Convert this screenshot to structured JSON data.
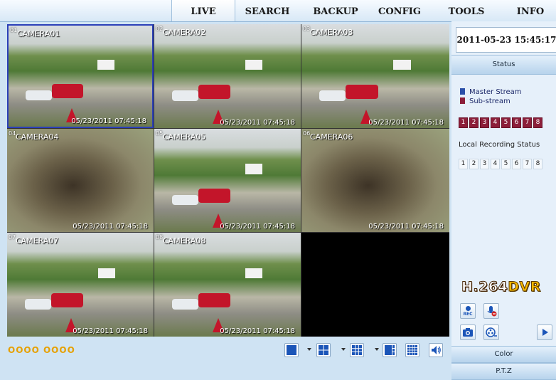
{
  "nav": {
    "tabs": [
      {
        "label": "LIVE",
        "active": true
      },
      {
        "label": "SEARCH",
        "active": false
      },
      {
        "label": "BACKUP",
        "active": false
      },
      {
        "label": "CONFIG",
        "active": false
      },
      {
        "label": "TOOLS",
        "active": false
      },
      {
        "label": "INFO",
        "active": false
      }
    ]
  },
  "grid": {
    "cells": [
      {
        "num": "01",
        "camera": "CAMERA01",
        "timestamp": "05/23/2011 07:45:18",
        "selected": true
      },
      {
        "num": "02",
        "camera": "CAMERA02",
        "timestamp": "05/23/2011 07:45:18",
        "selected": false
      },
      {
        "num": "03",
        "camera": "CAMERA03",
        "timestamp": "05/23/2011 07:45:18",
        "selected": false
      },
      {
        "num": "04",
        "camera": "CAMERA04",
        "timestamp": "05/23/2011 07:45:18",
        "selected": false
      },
      {
        "num": "05",
        "camera": "CAMERA05",
        "timestamp": "05/23/2011 07:45:18",
        "selected": false
      },
      {
        "num": "06",
        "camera": "CAMERA06",
        "timestamp": "05/23/2011 07:45:18",
        "selected": false
      },
      {
        "num": "07",
        "camera": "CAMERA07",
        "timestamp": "05/23/2011 07:45:18",
        "selected": false
      },
      {
        "num": "08",
        "camera": "CAMERA08",
        "timestamp": "05/23/2011 07:45:18",
        "selected": false
      },
      {
        "num": "",
        "camera": "",
        "timestamp": "",
        "selected": false
      }
    ]
  },
  "panel": {
    "datetime": "2011-05-23 15:45:17",
    "status_label": "Status",
    "master_stream_label": "Master Stream",
    "sub_stream_label": "Sub-stream",
    "master_color": "#2a4fa8",
    "sub_color": "#8c1f3a",
    "stream_channels": [
      "1",
      "2",
      "3",
      "4",
      "5",
      "6",
      "7",
      "8"
    ],
    "local_recording_label": "Local Recording Status",
    "recording_channels": [
      "1",
      "2",
      "3",
      "4",
      "5",
      "6",
      "7",
      "8"
    ],
    "logo_h264": "H.264",
    "logo_dvr": "DVR",
    "rec_label": "REC",
    "color_label": "Color",
    "ptz_label": "P.T.Z"
  },
  "bottom": {
    "indicator_dots": "OOOO OOOO",
    "layout_buttons": [
      "layout-1-icon",
      "layout-4-icon",
      "layout-9-icon",
      "layout-16-icon",
      "layout-custom-icon",
      "volume-icon"
    ]
  }
}
